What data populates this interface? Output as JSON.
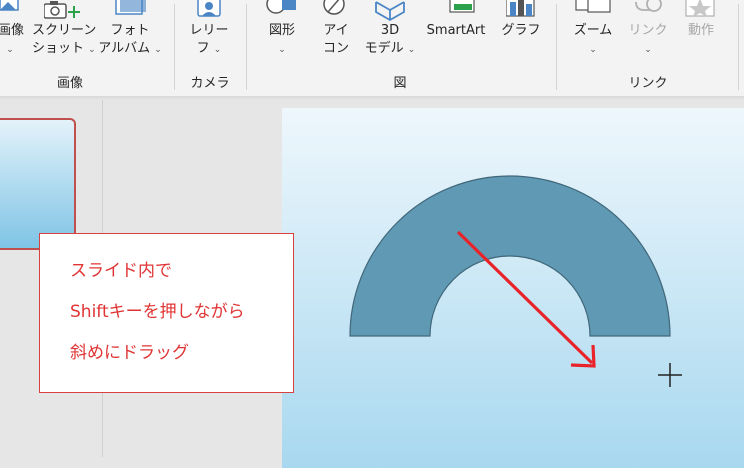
{
  "ribbon": {
    "groups": {
      "image": "画像",
      "camera": "カメラ",
      "illustrations": "図",
      "links": "リンク"
    },
    "buttons": {
      "picture_line1": "画像",
      "screenshot_line1": "スクリーン",
      "screenshot_line2": "ショット",
      "photo_album_line1": "フォト",
      "photo_album_line2": "アルバム",
      "cameo_line1": "レリー",
      "cameo_line2": "フ",
      "shapes": "図形",
      "icons_line1": "アイ",
      "icons_line2": "コン",
      "models_line1": "3D",
      "models_line2": "モデル",
      "smartart": "SmartArt",
      "chart": "グラフ",
      "zoom": "ズーム",
      "link": "リンク",
      "action": "動作"
    },
    "chevron": "⌄"
  },
  "callout": {
    "line1": "スライド内で",
    "line2": "Shiftキーを押しながら",
    "line3": "斜めにドラッグ"
  },
  "colors": {
    "shape_fill": "#5f99b3",
    "arrow": "#e8232a",
    "callout_text": "#e03434"
  }
}
